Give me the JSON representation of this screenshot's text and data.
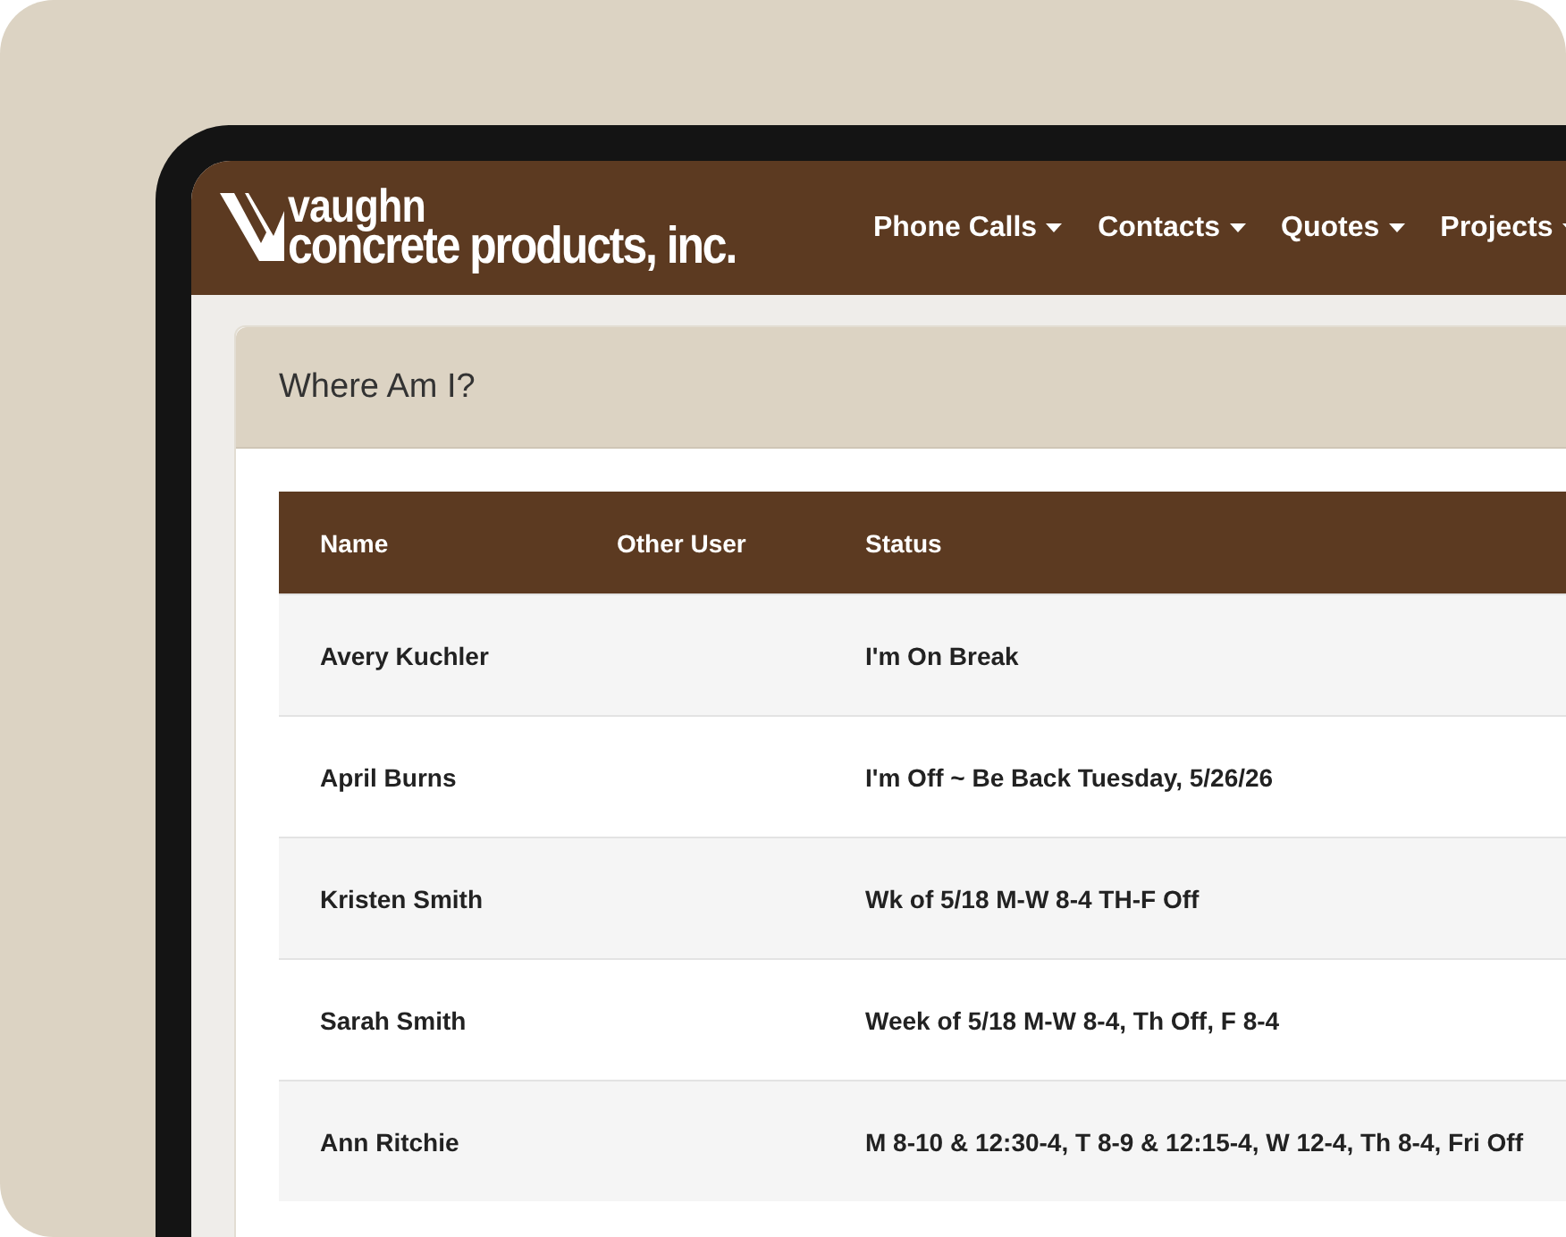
{
  "header": {
    "logo": {
      "line_1": "vaughn",
      "line_2": "concrete products, inc."
    },
    "nav": [
      {
        "label": "Phone Calls"
      },
      {
        "label": "Contacts"
      },
      {
        "label": "Quotes"
      },
      {
        "label": "Projects"
      }
    ]
  },
  "panel": {
    "title": "Where Am I?"
  },
  "table": {
    "columns": [
      "Name",
      "Other User",
      "Status"
    ],
    "rows": [
      {
        "name": "Avery Kuchler",
        "other_user": "",
        "status": "I'm On Break"
      },
      {
        "name": "April Burns",
        "other_user": "",
        "status": "I'm Off ~ Be Back Tuesday, 5/26/26"
      },
      {
        "name": "Kristen Smith",
        "other_user": "",
        "status": "Wk of 5/18 M-W 8-4 TH-F Off"
      },
      {
        "name": "Sarah Smith",
        "other_user": "",
        "status": "Week of 5/18 M-W 8-4, Th Off, F 8-4"
      },
      {
        "name": "Ann Ritchie",
        "other_user": "",
        "status": "M 8-10 & 12:30-4, T 8-9 & 12:15-4, W 12-4, Th 8-4, Fri Off"
      }
    ]
  }
}
